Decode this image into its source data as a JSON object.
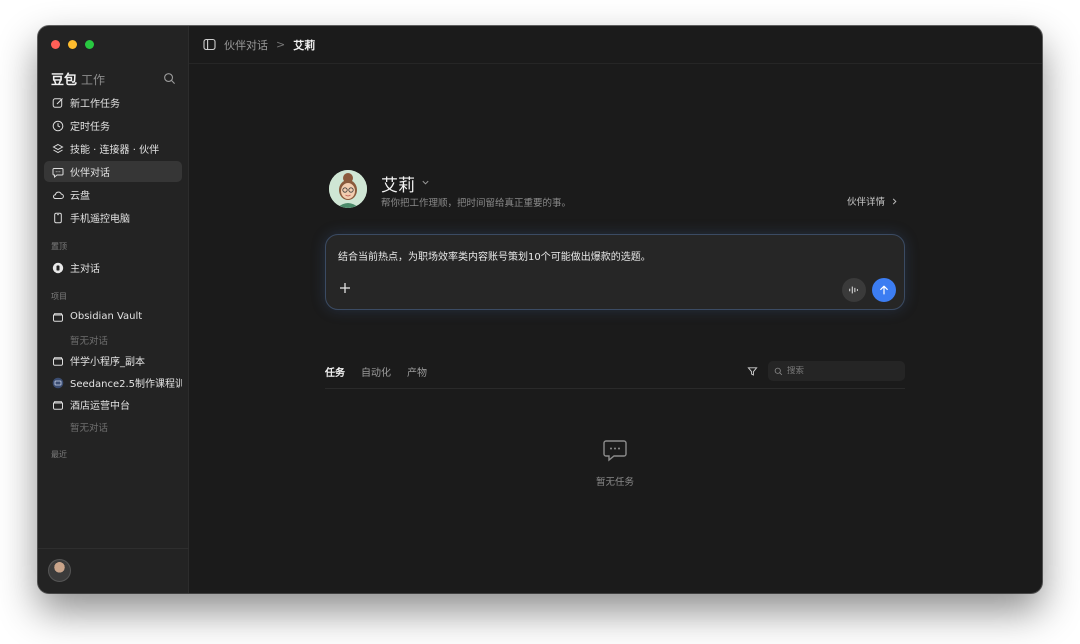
{
  "window": {
    "traffic_lights": [
      "#ff5f57",
      "#febc2e",
      "#28c840"
    ]
  },
  "sidebar": {
    "app_name": "豆包",
    "app_sub": "工作",
    "nav": [
      {
        "label": "新工作任务",
        "icon": "edit-icon"
      },
      {
        "label": "定时任务",
        "icon": "clock-icon"
      },
      {
        "label": "技能 · 连接器 · 伙伴",
        "icon": "layers-icon"
      },
      {
        "label": "伙伴对话",
        "icon": "chat-icon",
        "active": true
      },
      {
        "label": "云盘",
        "icon": "cloud-icon"
      },
      {
        "label": "手机遥控电脑",
        "icon": "phone-icon"
      }
    ],
    "pinned_label": "置顶",
    "pinned": [
      {
        "label": "主对话",
        "icon": "main-chat-icon"
      }
    ],
    "projects_label": "项目",
    "projects": [
      {
        "label": "Obsidian Vault",
        "empty": "暂无对话"
      },
      {
        "label": "伴学小程序_副本"
      },
      {
        "label": "Seedance2.5制作课程训"
      },
      {
        "label": "酒店运营中台",
        "empty": "暂无对话"
      }
    ],
    "recent_label": "最近"
  },
  "topbar": {
    "crumb": "伙伴对话",
    "separator": ">",
    "current": "艾莉"
  },
  "partner": {
    "name": "艾莉",
    "description": "帮你把工作理顺，把时间留给真正重要的事。",
    "detail_link": "伙伴详情"
  },
  "composer": {
    "text": "结合当前热点，为职场效率类内容账号策划10个可能做出爆款的选题。",
    "send_color": "#3c7df2"
  },
  "tabs": [
    {
      "label": "任务",
      "active": true
    },
    {
      "label": "自动化"
    },
    {
      "label": "产物"
    }
  ],
  "search": {
    "placeholder": "搜索"
  },
  "empty_state": {
    "text": "暂无任务"
  }
}
